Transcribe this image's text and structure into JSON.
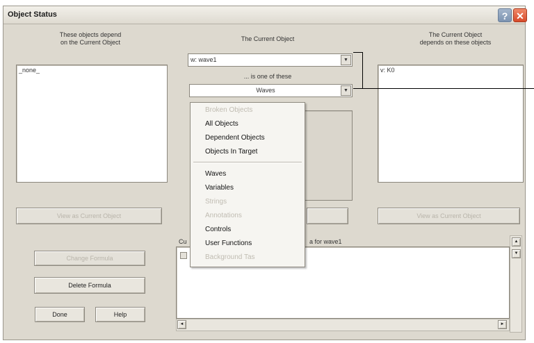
{
  "window": {
    "title": "Object Status",
    "help_glyph": "?",
    "close_glyph": "✕"
  },
  "left_panel": {
    "label": "These objects depend\non the Current Object",
    "list_items": [
      "_none_"
    ],
    "view_button": "View as Current Object"
  },
  "center_panel": {
    "label": "The Current Object",
    "current_object": "w: wave1",
    "is_one_of_label": "... is one of these",
    "type_selected": "Waves",
    "formula_label_prefix": "Cu",
    "formula_label_suffix": "a for wave1"
  },
  "right_panel": {
    "label": "The Current Object\ndepends on these objects",
    "list_items": [
      "v: K0"
    ],
    "view_button": "View as Current Object"
  },
  "buttons": {
    "change_formula": "Change Formula",
    "delete_formula": "Delete Formula",
    "done": "Done",
    "help": "Help"
  },
  "menu": {
    "items": [
      {
        "label": "Broken Objects",
        "enabled": false
      },
      {
        "label": "All Objects",
        "enabled": true
      },
      {
        "label": "Dependent Objects",
        "enabled": true
      },
      {
        "label": "Objects In Target",
        "enabled": true
      },
      {
        "label": "Waves",
        "enabled": true
      },
      {
        "label": "Variables",
        "enabled": true
      },
      {
        "label": "Strings",
        "enabled": false
      },
      {
        "label": "Annotations",
        "enabled": false
      },
      {
        "label": "Controls",
        "enabled": true
      },
      {
        "label": "User Functions",
        "enabled": true
      },
      {
        "label": "Background Tas",
        "enabled": false
      }
    ]
  },
  "icons": {
    "dropdown_arrow": "▼",
    "scroll_up": "▲",
    "scroll_down": "▼",
    "scroll_left": "◄",
    "scroll_right": "►"
  }
}
